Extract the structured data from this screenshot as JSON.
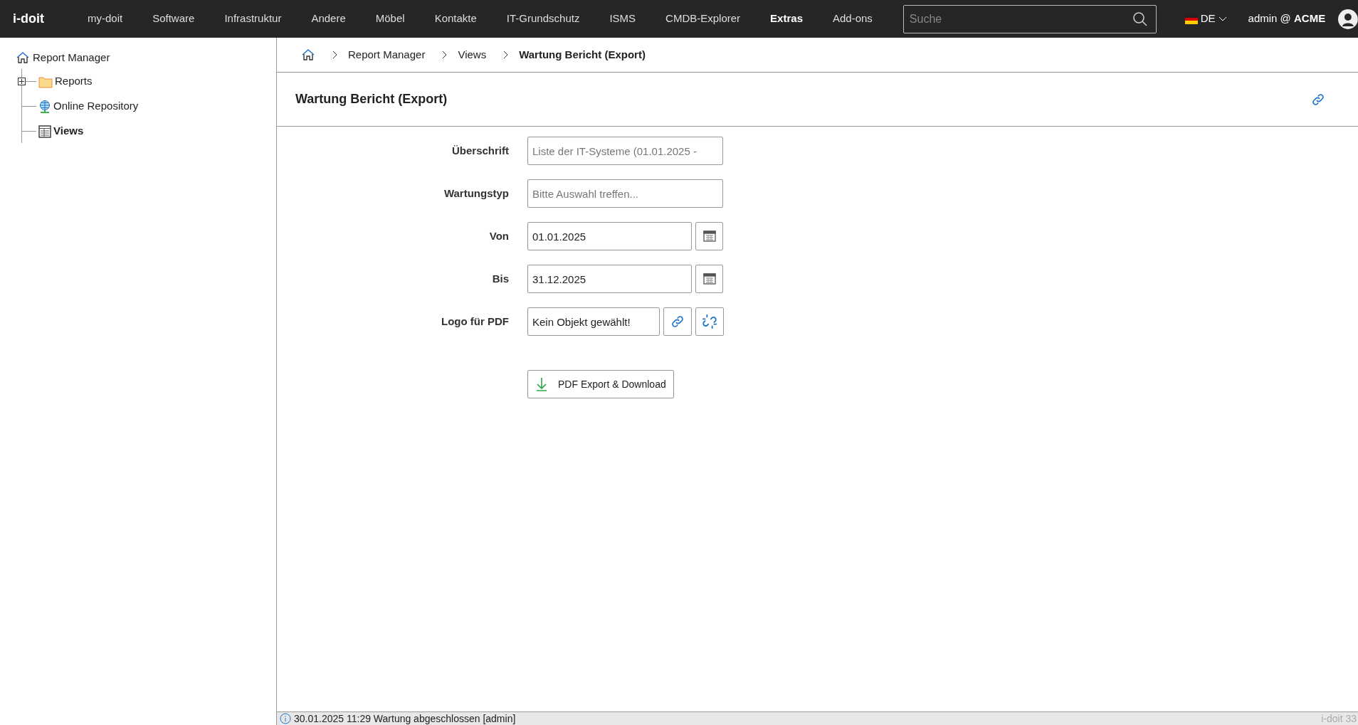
{
  "topbar": {
    "logo": "i-doit",
    "nav": [
      {
        "label": "my-doit",
        "selected": false
      },
      {
        "label": "Software",
        "selected": false
      },
      {
        "label": "Infrastruktur",
        "selected": false
      },
      {
        "label": "Andere",
        "selected": false
      },
      {
        "label": "Möbel",
        "selected": false
      },
      {
        "label": "Kontakte",
        "selected": false
      },
      {
        "label": "IT-Grundschutz",
        "selected": false
      },
      {
        "label": "ISMS",
        "selected": false
      },
      {
        "label": "CMDB-Explorer",
        "selected": false
      },
      {
        "label": "Extras",
        "selected": true
      },
      {
        "label": "Add-ons",
        "selected": false
      }
    ],
    "search": {
      "placeholder": "Suche"
    },
    "language": "DE",
    "user": "admin @ ",
    "tenant": "ACME"
  },
  "sidebar": {
    "root": "Report Manager",
    "items": [
      {
        "label": "Reports",
        "kind": "folder",
        "expanded": false,
        "selected": false
      },
      {
        "label": "Online Repository",
        "kind": "globe",
        "selected": false
      },
      {
        "label": "Views",
        "kind": "table",
        "selected": true
      }
    ]
  },
  "breadcrumb": [
    "Report Manager",
    "Views",
    "Wartung Bericht (Export)"
  ],
  "title": "Wartung Bericht (Export)",
  "form": [
    {
      "label": "Überschrift",
      "kind": "text",
      "placeholder": "Liste der IT-Systeme (01.01.2025 -"
    },
    {
      "label": "Wartungstyp",
      "kind": "text",
      "placeholder": "Bitte Auswahl treffen..."
    },
    {
      "label": "Von",
      "kind": "date",
      "value": "01.01.2025"
    },
    {
      "label": "Bis",
      "kind": "date",
      "value": "31.12.2025"
    },
    {
      "label": "Logo für PDF",
      "kind": "object",
      "value": "Kein Objekt gewählt!"
    }
  ],
  "export_button": "PDF Export & Download",
  "status_bar": {
    "message": "30.01.2025 11:29 Wartung abgeschlossen [admin]",
    "version": "i-doit 33"
  }
}
